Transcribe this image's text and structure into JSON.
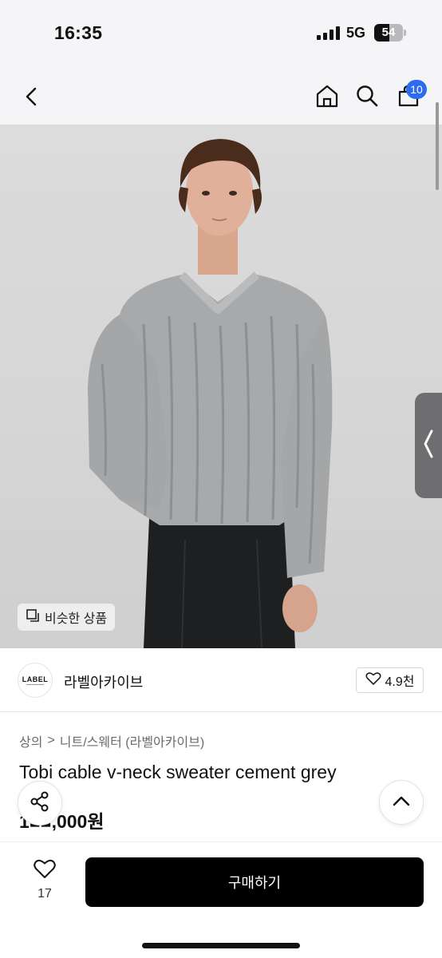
{
  "status_bar": {
    "time": "16:35",
    "network": "5G",
    "battery": "54",
    "battery_level": 0.54
  },
  "nav": {
    "cart_badge": "10",
    "icons": [
      "back-icon",
      "home-icon",
      "search-icon",
      "cart-icon"
    ]
  },
  "hero": {
    "similar_label": "비슷한 상품"
  },
  "seller": {
    "logo_text": "LABEL",
    "name": "라벨아카이브",
    "likes": "4.9천"
  },
  "breadcrumb": {
    "category": "상의",
    "separator": ">",
    "subcategory": "니트/스웨터 (라벨아카이브)"
  },
  "product": {
    "title": "Tobi cable v-neck sweater cement grey",
    "price": "1■■,000원"
  },
  "bottom_bar": {
    "wish_count": "17",
    "buy_label": "구매하기"
  },
  "colors": {
    "accent": "#2d6cf0",
    "buy_button": "#000000",
    "side_tab": "#6e6e70"
  }
}
